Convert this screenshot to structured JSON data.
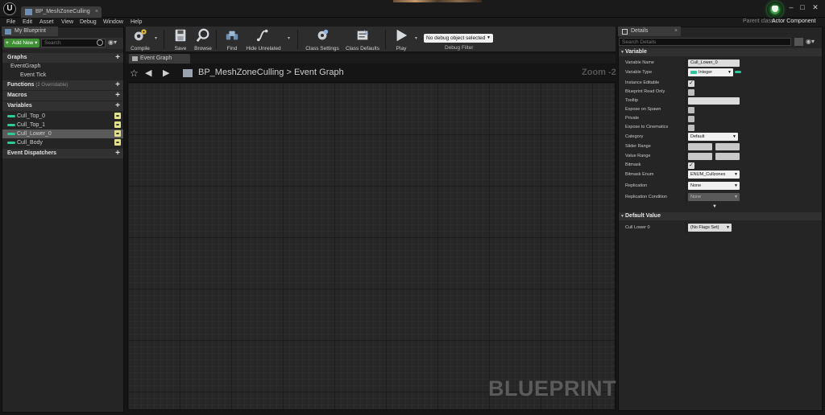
{
  "titlebar": {
    "tab_label": "BP_MeshZoneCulling",
    "tab_close": "×",
    "logo": "U",
    "buttons": {
      "minimize": "–",
      "maximize": "□",
      "close": "✕"
    }
  },
  "menu": [
    "File",
    "Edit",
    "Asset",
    "View",
    "Debug",
    "Window",
    "Help"
  ],
  "parent_class": {
    "label": "Parent class:",
    "value": "Actor Component"
  },
  "my_blueprint": {
    "tab_label": "My Blueprint",
    "add_new": "Add New",
    "search_placeholder": "Search",
    "sections": {
      "graphs": "Graphs",
      "functions": "Functions",
      "functions_count": "(2 Overridable)",
      "macros": "Macros",
      "variables": "Variables",
      "dispatchers": "Event Dispatchers"
    },
    "graph_items": [
      "EventGraph",
      "Event Tick"
    ],
    "variables": [
      "Cull_Top_0",
      "Cull_Top_1",
      "Cull_Lower_0",
      "Cull_Body"
    ],
    "selected_variable": "Cull_Lower_0"
  },
  "toolbar": {
    "compile": "Compile",
    "save": "Save",
    "browse": "Browse",
    "find": "Find",
    "hide_unrelated": "Hide Unrelated",
    "class_settings": "Class Settings",
    "class_defaults": "Class Defaults",
    "play": "Play",
    "debug_select": "No debug object selected",
    "debug_filter": "Debug Filter"
  },
  "graph": {
    "tab_label": "Event Graph",
    "breadcrumb_root": "BP_MeshZoneCulling",
    "breadcrumb_sep": ">",
    "breadcrumb_leaf": "Event Graph",
    "zoom": "Zoom -2",
    "watermark": "BLUEPRINT"
  },
  "details": {
    "tab_label": "Details",
    "tab_close": "×",
    "search_placeholder": "Search Details",
    "section_variable": "Variable",
    "section_default": "Default Value",
    "labels": {
      "name": "Variable Name",
      "type": "Variable Type",
      "instance_editable": "Instance Editable",
      "read_only": "Blueprint Read Only",
      "tooltip": "Tooltip",
      "expose_spawn": "Expose on Spawn",
      "private": "Private",
      "expose_cinematics": "Expose to Cinematics",
      "category": "Category",
      "slider_range": "Slider Range",
      "value_range": "Value Range",
      "bitmask": "Bitmask",
      "bitmask_enum": "Bitmask Enum",
      "replication": "Replication",
      "replication_condition": "Replication Condition",
      "default_label": "Cull Lower 0"
    },
    "values": {
      "name": "Cull_Lower_0",
      "type": "Integer",
      "category": "Default",
      "bitmask_enum": "ENUM_Cullzones",
      "replication": "None",
      "replication_condition": "None",
      "default_value": "(No Flags Set)"
    },
    "checked": {
      "instance_editable": true,
      "read_only": false,
      "expose_spawn": false,
      "private": false,
      "expose_cinematics": false,
      "bitmask": true
    }
  },
  "colors": {
    "accent_green": "#3f8f35",
    "variable_pin": "#30c79a",
    "eye_yellow": "#e3e08c"
  },
  "icons": [
    "unreal-logo-icon",
    "blueprint-icon",
    "plus-icon",
    "search-icon",
    "eye-icon",
    "compile-icon",
    "save-icon",
    "browse-icon",
    "find-icon",
    "hide-unrelated-icon",
    "class-settings-icon",
    "class-defaults-icon",
    "play-icon",
    "star-icon",
    "back-arrow-icon",
    "forward-arrow-icon"
  ]
}
